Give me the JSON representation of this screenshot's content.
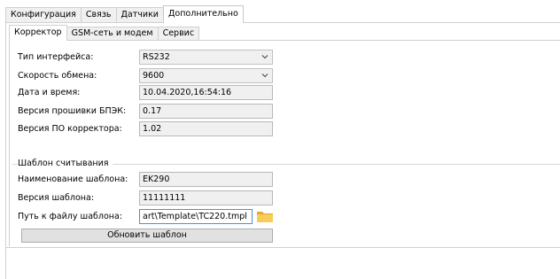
{
  "top_tabs": [
    "Конфигурация",
    "Связь",
    "Датчики",
    "Дополнительно"
  ],
  "active_top_tab": "Дополнительно",
  "sub_tabs": [
    "Корректор",
    "GSM-сеть и модем",
    "Сервис"
  ],
  "active_sub_tab": "Корректор",
  "settings": {
    "interface_type": {
      "label": "Тип интерфейса:",
      "value": "RS232"
    },
    "baud_rate": {
      "label": "Скорость обмена:",
      "value": "9600"
    },
    "datetime": {
      "label": "Дата и время:",
      "value": "10.04.2020,16:54:16"
    },
    "bpek_firmware": {
      "label": "Версия прошивки БПЭК:",
      "value": "0.17"
    },
    "corrector_version": {
      "label": "Версия ПО корректора:",
      "value": "1.02"
    }
  },
  "template_group": {
    "title": "Шаблон считывания",
    "name": {
      "label": "Наименование шаблона:",
      "value": "EK290"
    },
    "version": {
      "label": "Версия шаблона:",
      "value": "11111111"
    },
    "path": {
      "label": "Путь к файлу шаблона:",
      "value": "art\\Template\\TC220.tmpl"
    },
    "folder_icon": "folder-icon",
    "update_button": "Обновить шаблон"
  },
  "colors": {
    "tab_border": "#d0d0d0",
    "field_bg": "#f0f0f0",
    "focus_border": "#4a90d9",
    "folder": "#f5c542"
  }
}
